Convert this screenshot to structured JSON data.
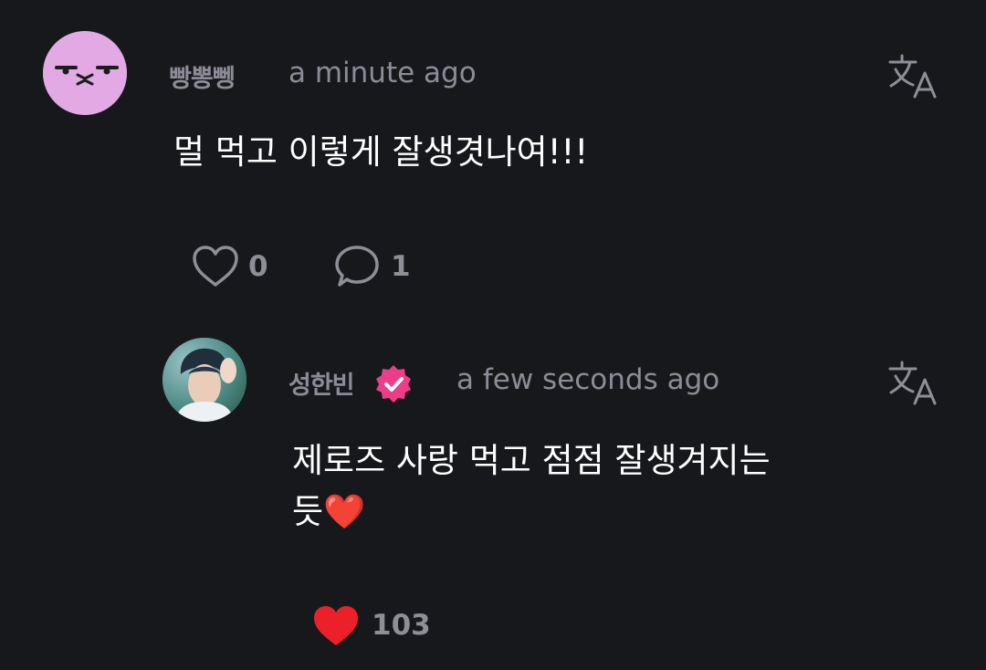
{
  "comment": {
    "username": "빵뽕뼁",
    "timestamp": "a minute ago",
    "text": "멀 먹고 이렇게 잘생겻나여!!!",
    "like_count": "0",
    "reply_count": "1"
  },
  "reply": {
    "username": "성한빈",
    "timestamp": "a few seconds ago",
    "text_line1": "제로즈 사랑 먹고 점점 잘생겨지는",
    "text_line2": "듯❤️",
    "like_count": "103"
  },
  "icons": {
    "translate": "translate-icon",
    "like": "heart-icon",
    "reply": "speech-bubble-icon",
    "verified": "verified-badge-icon"
  },
  "colors": {
    "background": "#17181b",
    "muted_text": "#8d8b97",
    "heart_red": "#ec2029",
    "verified_pink": "#ee3d88"
  }
}
